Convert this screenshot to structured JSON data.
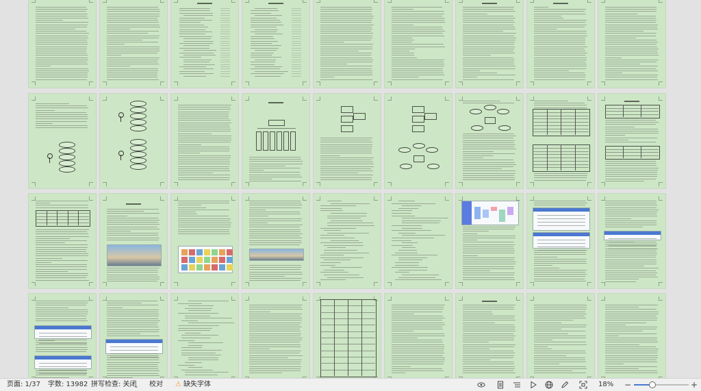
{
  "status_bar": {
    "page": "页面: 1/37",
    "word_count": "字数: 13982",
    "spell_check": "拼写检查: 关闭",
    "proofread": "校对",
    "missing_font": "缺失字体",
    "zoom": "18%",
    "zoom_fraction": 0.32
  },
  "icons": [
    "chevron-down-icon",
    "warning-icon",
    "eye-icon",
    "document-icon",
    "list-icon",
    "play-icon",
    "globe-icon",
    "pen-icon",
    "fit-page-icon",
    "zoom-out-icon",
    "zoom-in-icon"
  ],
  "colors": {
    "page_bg": "#cde6c5",
    "workspace_bg": "#e2e2e2",
    "status_bg": "#f0f0f0",
    "accent_blue": "#4a78d0"
  }
}
